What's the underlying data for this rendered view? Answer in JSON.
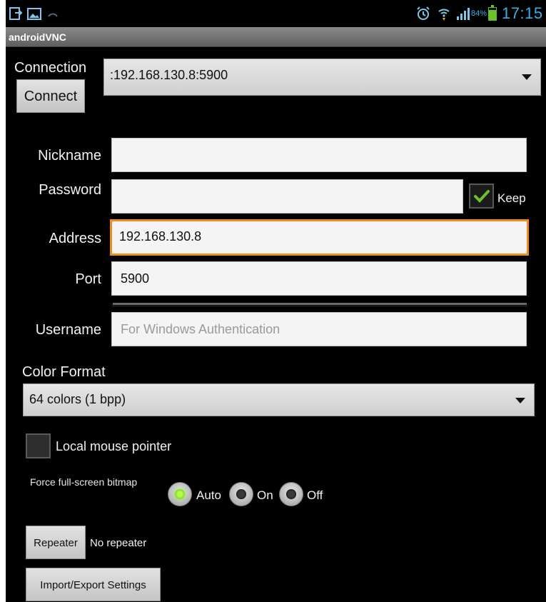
{
  "status_bar": {
    "battery_percent": "84%",
    "battery_level": 0.84,
    "time": "17:15",
    "left_icons": [
      "usb-icon",
      "gallery-icon",
      "sync-icon"
    ],
    "right_icons": [
      "alarm-icon",
      "wifi-icon",
      "signal-icon",
      "battery-icon"
    ],
    "accent_color": "#36b1e6"
  },
  "title_bar": {
    "title": "androidVNC"
  },
  "connection": {
    "label": "Connection",
    "selected": ":192.168.130.8:5900",
    "connect_button": "Connect"
  },
  "form": {
    "nickname": {
      "label": "Nickname",
      "value": ""
    },
    "password": {
      "label": "Password",
      "value": "",
      "keep_label": "Keep",
      "keep_checked": true
    },
    "address": {
      "label": "Address",
      "value": "192.168.130.8"
    },
    "port": {
      "label": "Port",
      "value": "5900"
    },
    "username": {
      "label": "Username",
      "placeholder": "For Windows Authentication"
    }
  },
  "color_format": {
    "label": "Color Format",
    "selected": "64 colors (1 bpp)"
  },
  "local_mouse": {
    "label": "Local mouse pointer",
    "checked": false
  },
  "fullscreen_bitmap": {
    "label": "Force full-screen bitmap",
    "options": [
      "Auto",
      "On",
      "Off"
    ],
    "selected": "Auto"
  },
  "repeater": {
    "button": "Repeater",
    "status": "No repeater"
  },
  "import_export": {
    "button": "Import/Export Settings"
  },
  "colors": {
    "focus_border": "#f08c1e",
    "radio_on": "#58c00c",
    "check": "#6cc12c"
  }
}
